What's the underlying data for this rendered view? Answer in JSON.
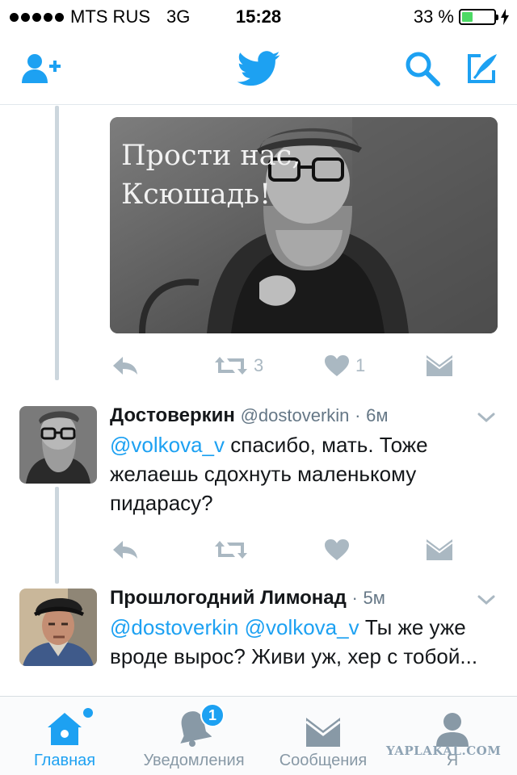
{
  "status_bar": {
    "carrier": "MTS RUS",
    "network": "3G",
    "time": "15:28",
    "battery": "33 %",
    "battery_level": 0.33,
    "battery_color": "#4cd964"
  },
  "nav": {
    "add_user_icon": "person-plus-icon",
    "logo_icon": "twitter-bird-icon",
    "search_icon": "search-icon",
    "compose_icon": "compose-icon",
    "accent_color": "#1da1f2"
  },
  "media_tweet": {
    "image_caption_line1": "Прости нас,",
    "image_caption_line2": "Ксюшадь!",
    "retweet_count": "3",
    "like_count": "1"
  },
  "tweets": [
    {
      "name": "Достоверкин",
      "handle": "@dostoverkin",
      "dot": "·",
      "time": "6м",
      "mention": "@volkova_v",
      "text": " спасибо, мать. Тоже желаешь сдохнуть маленькому пидарасу?"
    },
    {
      "name": "Прошлогодний Лимонад",
      "dot": "·",
      "time": "5м",
      "mention1": "@dostoverkin",
      "mention2": "@volkova_v",
      "text": " Ты же уже вроде вырос? Живи уж, хер с тобой..."
    }
  ],
  "tabs": [
    {
      "label": "Главная",
      "icon": "home-icon",
      "active": true
    },
    {
      "label": "Уведомления",
      "icon": "bell-icon",
      "badge": "1"
    },
    {
      "label": "Сообщения",
      "icon": "envelope-icon"
    },
    {
      "label": "Я",
      "icon": "profile-icon"
    }
  ],
  "watermark": "YAPLAKAL.COM"
}
